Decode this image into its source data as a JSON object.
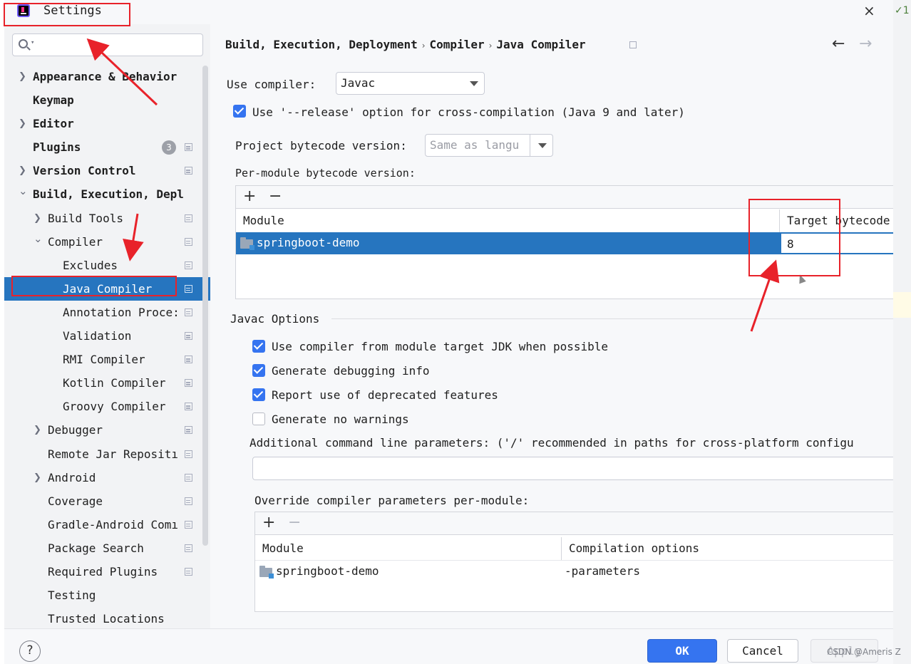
{
  "window": {
    "title": "Settings",
    "close_icon": "×"
  },
  "edge": {
    "fragment": "1"
  },
  "sidebar": {
    "search": {
      "placeholder": "",
      "value": ""
    },
    "items": [
      {
        "label": "Appearance & Behavior",
        "expandable": true,
        "expanded": false,
        "bold": true
      },
      {
        "label": "Keymap",
        "expandable": false,
        "bold": true
      },
      {
        "label": "Editor",
        "expandable": true,
        "expanded": false,
        "bold": true
      },
      {
        "label": "Plugins",
        "expandable": false,
        "bold": true,
        "badge": "3"
      },
      {
        "label": "Version Control",
        "expandable": true,
        "expanded": false,
        "bold": true
      },
      {
        "label": "Build, Execution, Depl",
        "expandable": true,
        "expanded": true,
        "bold": true
      },
      {
        "label": "Build Tools",
        "expandable": true,
        "expanded": false
      },
      {
        "label": "Compiler",
        "expandable": true,
        "expanded": true
      },
      {
        "label": "Excludes"
      },
      {
        "label": "Java Compiler",
        "selected": true
      },
      {
        "label": "Annotation Proce:"
      },
      {
        "label": "Validation"
      },
      {
        "label": "RMI Compiler"
      },
      {
        "label": "Kotlin Compiler"
      },
      {
        "label": "Groovy Compiler"
      },
      {
        "label": "Debugger",
        "expandable": true,
        "expanded": false
      },
      {
        "label": "Remote Jar Repositı"
      },
      {
        "label": "Android",
        "expandable": true,
        "expanded": false
      },
      {
        "label": "Coverage"
      },
      {
        "label": "Gradle-Android Comı"
      },
      {
        "label": "Package Search"
      },
      {
        "label": "Required Plugins"
      },
      {
        "label": "Testing"
      },
      {
        "label": "Trusted Locations"
      }
    ]
  },
  "breadcrumb": [
    "Build, Execution, Deployment",
    "Compiler",
    "Java Compiler"
  ],
  "breadcrumb_sep": "›",
  "nav": {
    "back": "←",
    "forward": "→"
  },
  "compiler": {
    "use_compiler_label": "Use compiler:",
    "use_compiler_value": "Javac",
    "release_option_label": "Use '--release' option for cross-compilation (Java 9 and later)",
    "release_option_checked": true,
    "bytecode_label": "Project bytecode version:",
    "bytecode_value": "Same as langu",
    "per_module_label": "Per-module bytecode version:",
    "per_module_table": {
      "add": "+",
      "remove": "−",
      "columns": [
        "Module",
        "Target bytecode"
      ],
      "rows": [
        {
          "module": "springboot-demo",
          "target": "8"
        }
      ]
    }
  },
  "javac": {
    "section_title": "Javac Options",
    "options": [
      {
        "label": "Use compiler from module target JDK when possible",
        "checked": true
      },
      {
        "label": "Generate debugging info",
        "checked": true
      },
      {
        "label": "Report use of deprecated features",
        "checked": true
      },
      {
        "label": "Generate no warnings",
        "checked": false
      }
    ],
    "additional_params_label": "Additional command line parameters:  ('/' recommended in paths for cross-platform configu",
    "additional_params_value": "",
    "override_label": "Override compiler parameters per-module:",
    "override_table": {
      "add": "+",
      "remove": "−",
      "columns": [
        "Module",
        "Compilation options"
      ],
      "rows": [
        {
          "module": "springboot-demo",
          "options": "-parameters"
        }
      ]
    }
  },
  "buttons": {
    "help": "?",
    "ok": "OK",
    "cancel": "Cancel",
    "apply": "Apply"
  },
  "watermark": "CSDN @Ameris Z",
  "colors": {
    "selection": "#2675bf",
    "primary": "#3574f0",
    "annotation": "#e8222a"
  }
}
